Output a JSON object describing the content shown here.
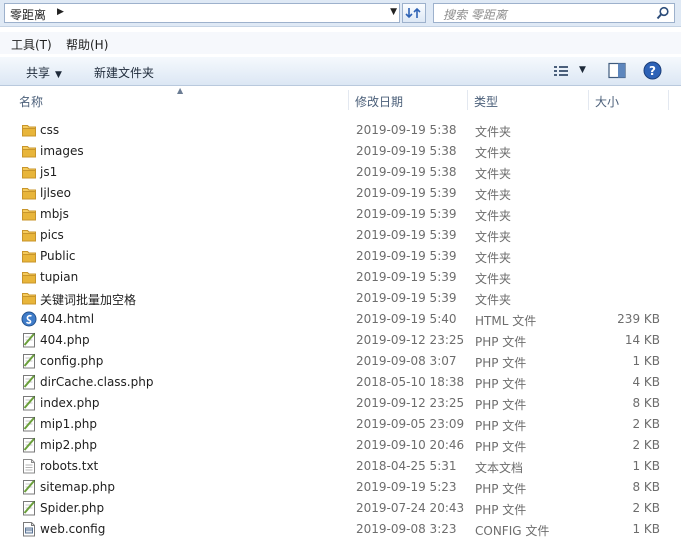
{
  "address": {
    "path": "零距离",
    "separator": "▶"
  },
  "search": {
    "placeholder": "搜索 零距离"
  },
  "menu": [
    {
      "label": "工具(T)"
    },
    {
      "label": "帮助(H)"
    }
  ],
  "toolbar": {
    "share_label": "共享",
    "new_folder_label": "新建文件夹"
  },
  "columns": {
    "name": "名称",
    "modified": "修改日期",
    "type": "类型",
    "size": "大小"
  },
  "files": [
    {
      "name": "css",
      "modified": "2019-09-19 5:38",
      "type": "文件夹",
      "size": "",
      "icon": "folder-icon"
    },
    {
      "name": "images",
      "modified": "2019-09-19 5:38",
      "type": "文件夹",
      "size": "",
      "icon": "folder-icon"
    },
    {
      "name": "js1",
      "modified": "2019-09-19 5:38",
      "type": "文件夹",
      "size": "",
      "icon": "folder-icon"
    },
    {
      "name": "ljlseo",
      "modified": "2019-09-19 5:39",
      "type": "文件夹",
      "size": "",
      "icon": "folder-icon"
    },
    {
      "name": "mbjs",
      "modified": "2019-09-19 5:39",
      "type": "文件夹",
      "size": "",
      "icon": "folder-icon"
    },
    {
      "name": "pics",
      "modified": "2019-09-19 5:39",
      "type": "文件夹",
      "size": "",
      "icon": "folder-icon"
    },
    {
      "name": "Public",
      "modified": "2019-09-19 5:39",
      "type": "文件夹",
      "size": "",
      "icon": "folder-icon"
    },
    {
      "name": "tupian",
      "modified": "2019-09-19 5:39",
      "type": "文件夹",
      "size": "",
      "icon": "folder-icon"
    },
    {
      "name": "关键词批量加空格",
      "modified": "2019-09-19 5:39",
      "type": "文件夹",
      "size": "",
      "icon": "folder-icon"
    },
    {
      "name": "404.html",
      "modified": "2019-09-19 5:40",
      "type": "HTML 文件",
      "size": "239 KB",
      "icon": "html-file-icon"
    },
    {
      "name": "404.php",
      "modified": "2019-09-12 23:25",
      "type": "PHP 文件",
      "size": "14 KB",
      "icon": "php-file-icon"
    },
    {
      "name": "config.php",
      "modified": "2019-09-08 3:07",
      "type": "PHP 文件",
      "size": "1 KB",
      "icon": "php-file-icon"
    },
    {
      "name": "dirCache.class.php",
      "modified": "2018-05-10 18:38",
      "type": "PHP 文件",
      "size": "4 KB",
      "icon": "php-file-icon"
    },
    {
      "name": "index.php",
      "modified": "2019-09-12 23:25",
      "type": "PHP 文件",
      "size": "8 KB",
      "icon": "php-file-icon"
    },
    {
      "name": "mip1.php",
      "modified": "2019-09-05 23:09",
      "type": "PHP 文件",
      "size": "2 KB",
      "icon": "php-file-icon"
    },
    {
      "name": "mip2.php",
      "modified": "2019-09-10 20:46",
      "type": "PHP 文件",
      "size": "2 KB",
      "icon": "php-file-icon"
    },
    {
      "name": "robots.txt",
      "modified": "2018-04-25 5:31",
      "type": "文本文档",
      "size": "1 KB",
      "icon": "text-file-icon"
    },
    {
      "name": "sitemap.php",
      "modified": "2019-09-19 5:23",
      "type": "PHP 文件",
      "size": "8 KB",
      "icon": "php-file-icon"
    },
    {
      "name": "Spider.php",
      "modified": "2019-07-24 20:43",
      "type": "PHP 文件",
      "size": "2 KB",
      "icon": "php-file-icon"
    },
    {
      "name": "web.config",
      "modified": "2019-09-08 3:23",
      "type": "CONFIG 文件",
      "size": "1 KB",
      "icon": "config-file-icon"
    }
  ],
  "colors": {
    "header_bg": "#dfe9f5",
    "toolbar_bg": "#dce7f4",
    "column_text": "#4c607a",
    "folder": "#e8b53a",
    "php_accent": "#6aa03a"
  }
}
